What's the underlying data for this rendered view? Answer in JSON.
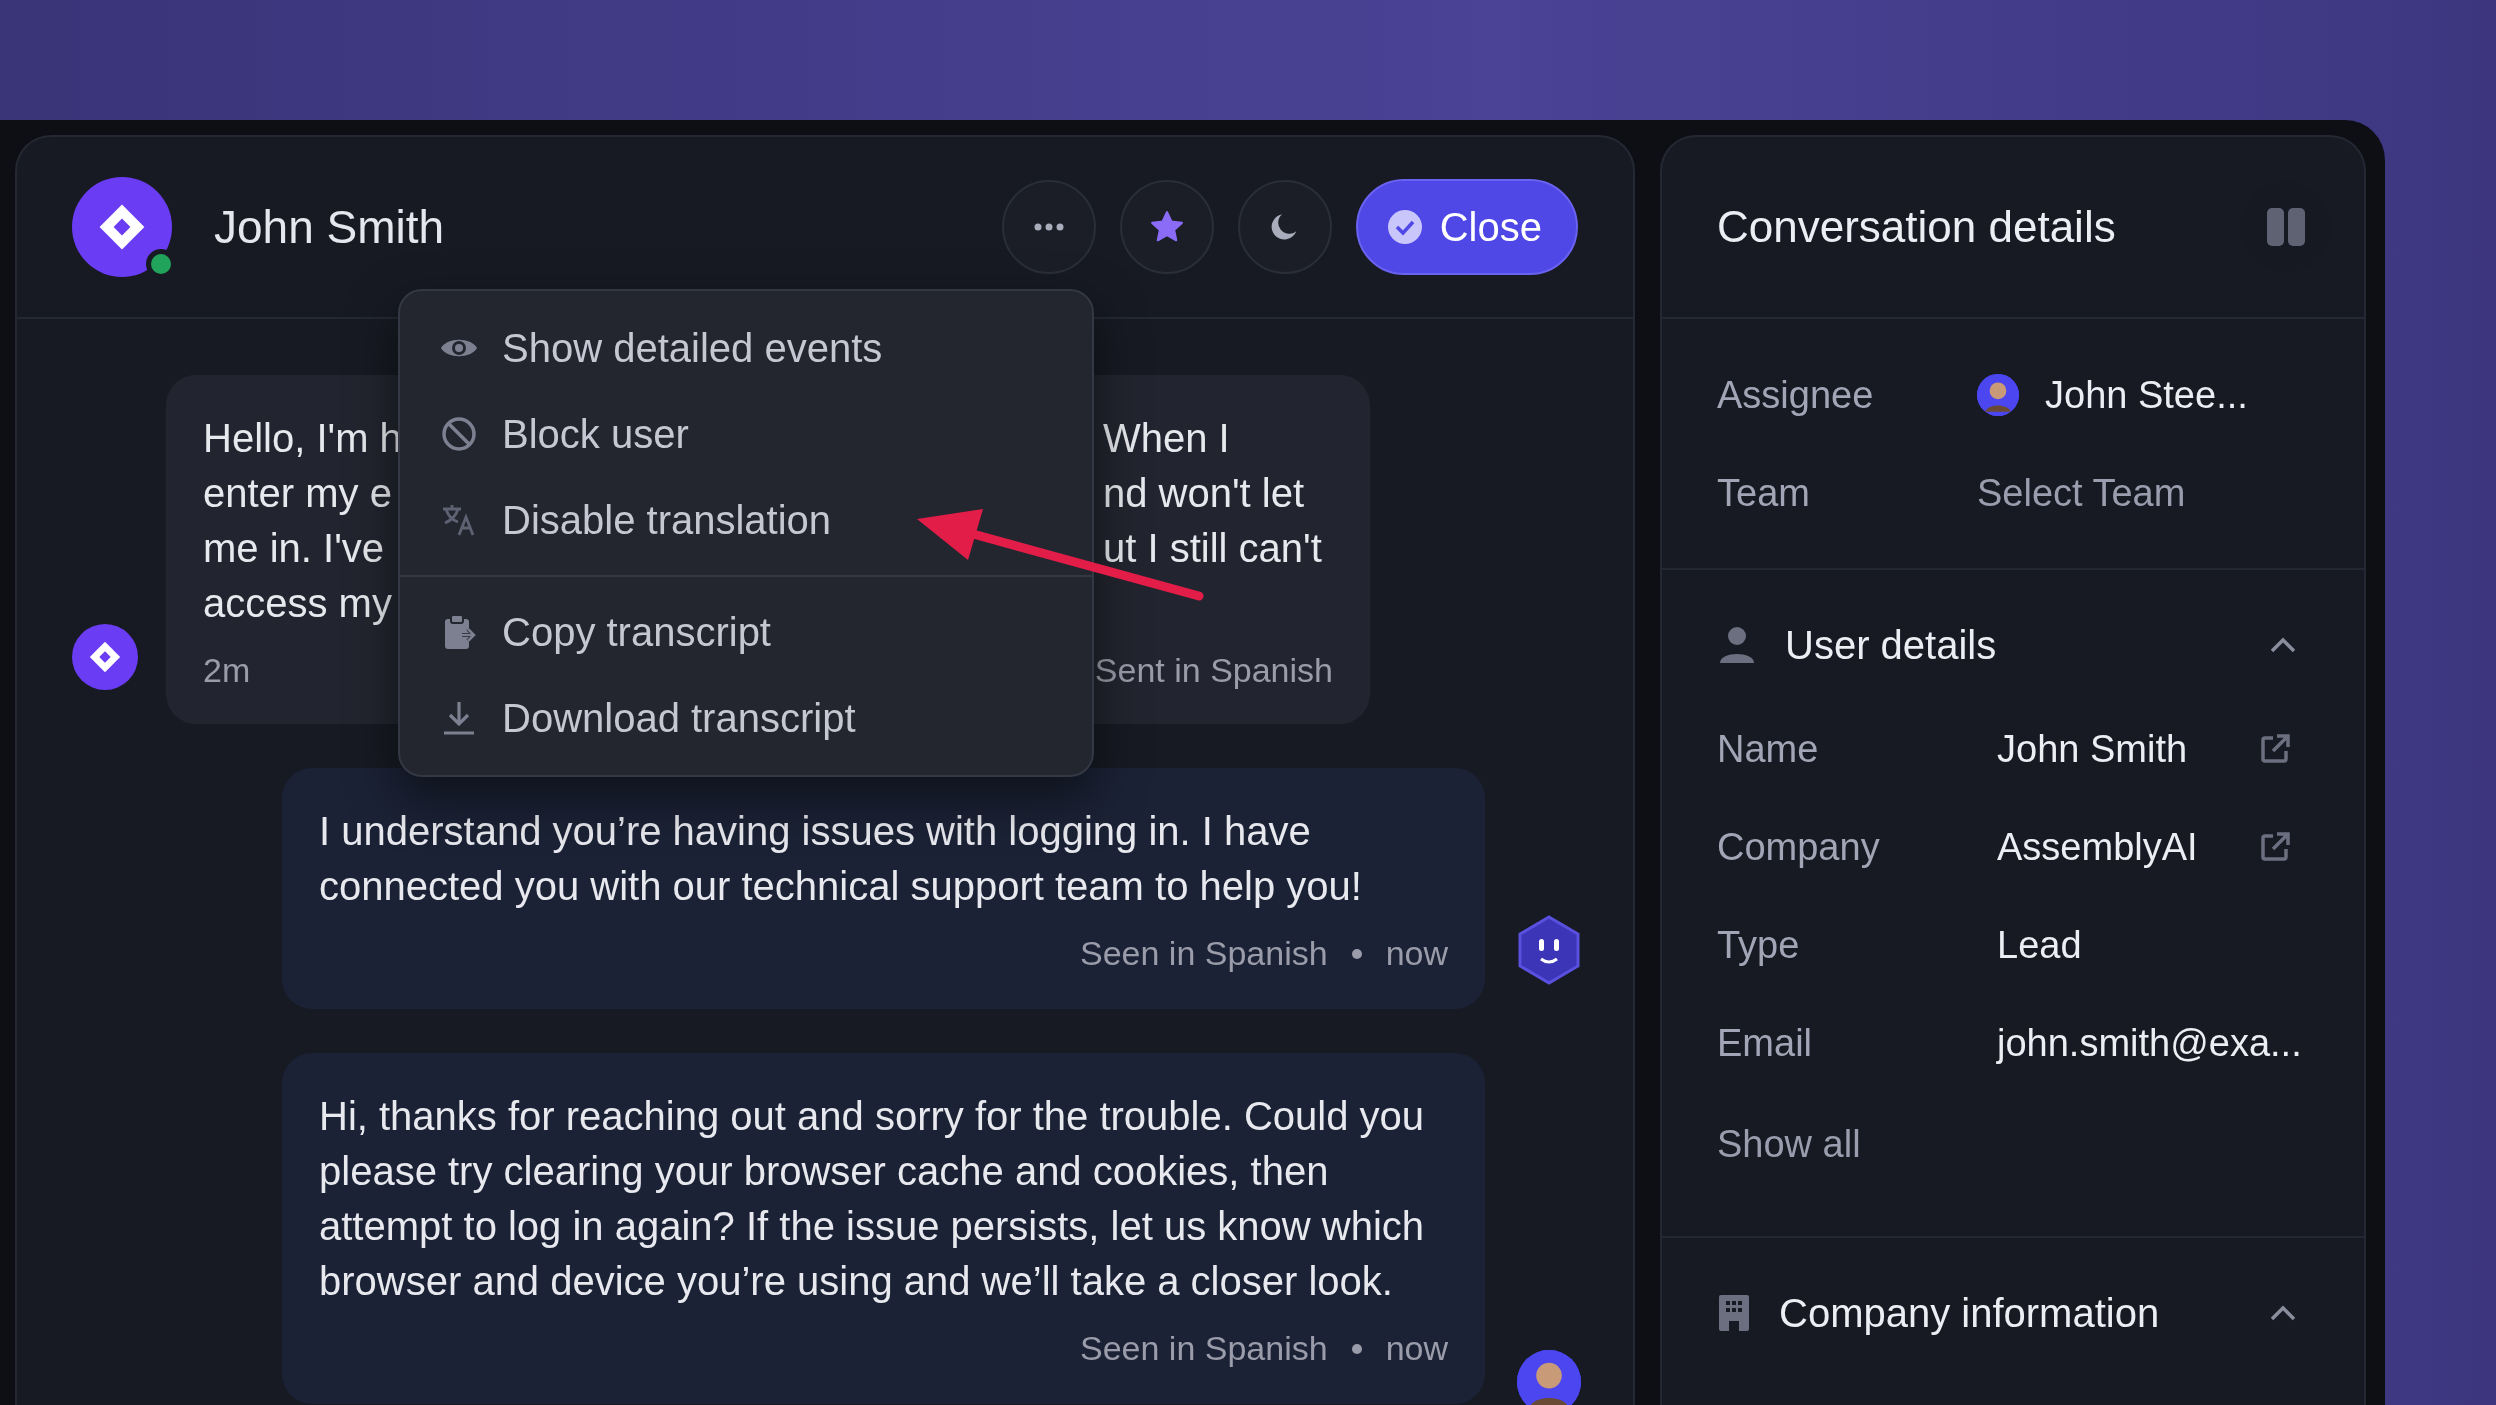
{
  "conversation": {
    "contact_name": "John Smith",
    "online": true,
    "header_actions": [
      {
        "kind": "more"
      },
      {
        "kind": "star"
      },
      {
        "kind": "theme"
      }
    ],
    "close_button": "Close"
  },
  "menu": {
    "sections": [
      [
        {
          "kind": "eye",
          "label": "Show detailed events"
        },
        {
          "kind": "block",
          "label": "Block user"
        },
        {
          "kind": "translate",
          "label": "Disable translation"
        }
      ],
      [
        {
          "kind": "clipboard",
          "label": "Copy transcript"
        },
        {
          "kind": "download",
          "label": "Download transcript"
        }
      ]
    ]
  },
  "messages": [
    {
      "kind": "user",
      "lines_left": [
        "Hello, I'm h",
        "enter my e",
        "me in. I've",
        "access my"
      ],
      "lines_right": [
        "When I",
        "nd won't let",
        "ut I still can't"
      ],
      "time": "2m",
      "status": "Sent in Spanish"
    },
    {
      "kind": "bot",
      "text": "I understand you’re having issues with logging in. I have connected you with our technical support team to help you!",
      "status": "Seen in Spanish",
      "time": "now"
    },
    {
      "kind": "agent",
      "text": "Hi, thanks for reaching out and sorry for the trouble. Could you please try clearing your browser cache and cookies, then attempt to log in again? If the issue persists, let us know which browser and device you’re using and we’ll take a closer look.",
      "status": "Seen in Spanish",
      "time": "now"
    }
  ],
  "details": {
    "title": "Conversation details",
    "fields": [
      {
        "kind": "assignee",
        "label": "Assignee",
        "value": "John Stee..."
      },
      {
        "kind": "select",
        "label": "Team",
        "value": "Select Team"
      }
    ],
    "sections": [
      {
        "kind": "user",
        "title": "User details",
        "expanded": true,
        "rows": [
          {
            "label": "Name",
            "value": "John Smith",
            "link": true
          },
          {
            "label": "Company",
            "value": "AssemblyAI",
            "link": true
          },
          {
            "label": "Type",
            "value": "Lead"
          },
          {
            "label": "Email",
            "value": "john.smith@exa..."
          }
        ],
        "show_all": "Show all"
      },
      {
        "kind": "company",
        "title": "Company information",
        "expanded": true
      }
    ]
  }
}
